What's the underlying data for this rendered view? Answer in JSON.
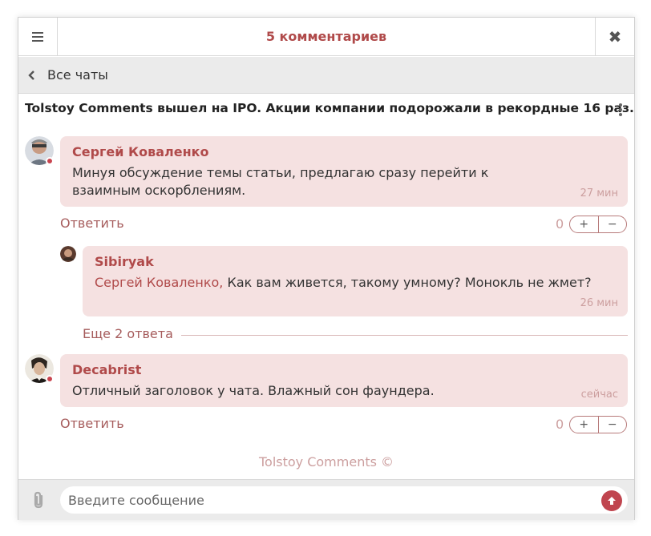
{
  "header": {
    "title": "5 комментариев",
    "menu_icon": "hamburger-icon",
    "close_icon": "close-icon",
    "close_glyph": "✖"
  },
  "nav": {
    "back_label": "Все чаты"
  },
  "chat": {
    "title": "Tolstoy Comments вышел на IPO. Акции компании подорожали в рекордные 16 раз."
  },
  "comments": [
    {
      "author": "Сергей Коваленко",
      "text": "Минуя обсуждение темы статьи, предлагаю сразу перейти к взаимным оскорблениям.",
      "time": "27 мин",
      "reply_label": "Ответить",
      "score": "0",
      "online": true
    },
    {
      "author": "Sibiryak",
      "mention": "Сергей Коваленко,",
      "text": "Как вам живется, такому умному? Монокль не жмет?",
      "time": "26 мин"
    },
    {
      "author": "Decabrist",
      "text": "Отличный заголовок у чата. Влажный сон фаундера.",
      "time": "сейчас",
      "reply_label": "Ответить",
      "score": "0",
      "online": true
    }
  ],
  "more_replies": "Еще 2 ответа",
  "vote": {
    "plus": "+",
    "minus": "−"
  },
  "footer": {
    "brand": "Tolstoy Comments ©"
  },
  "composer": {
    "placeholder": "Введите сообщение",
    "attach_icon": "paperclip-icon",
    "send_icon": "send-arrow-icon"
  },
  "colors": {
    "accent": "#b04a4a",
    "bubble": "#f5e1e1",
    "online": "#c9454f"
  }
}
